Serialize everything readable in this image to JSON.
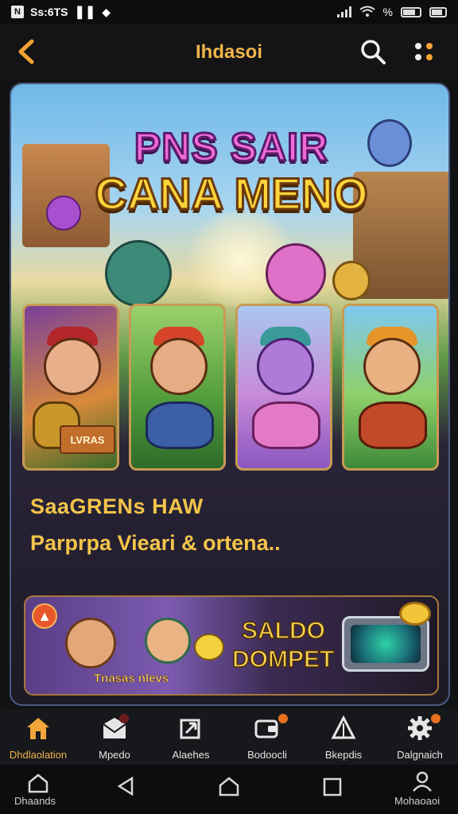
{
  "status_bar": {
    "time_text": "Ss:6TS",
    "battery_text": "%",
    "icons": [
      "notification-icon",
      "app-icon",
      "tag-icon",
      "signal-icon",
      "wifi-icon",
      "battery-icon",
      "cast-icon"
    ]
  },
  "header": {
    "title": "Ihdasoi",
    "back_icon": "chevron-left-icon",
    "search_icon": "search-icon",
    "more_icon": "more-dots-icon",
    "accent_color": "#f4a233"
  },
  "hero": {
    "line1": "PNS SAIR",
    "line2": "CANA MENO"
  },
  "game_tiles": [
    {
      "name": "tile-1",
      "tag": "LVRAS"
    },
    {
      "name": "tile-2"
    },
    {
      "name": "tile-3"
    },
    {
      "name": "tile-4"
    }
  ],
  "promo": {
    "title": "SaaGRENs HAW",
    "subtitle": "Parprpa Vieari & ortena.."
  },
  "banner": {
    "caption": "Tnasas nlevs",
    "saldo": "SALDO",
    "dompet": "DOMPET"
  },
  "bottom_nav": [
    {
      "label": "Dhdlaolation",
      "icon": "home-icon",
      "active": true
    },
    {
      "label": "Mpedo",
      "icon": "mail-icon",
      "active": false
    },
    {
      "label": "Alaehes",
      "icon": "upload-icon",
      "active": false
    },
    {
      "label": "Bodoocli",
      "icon": "wallet-icon",
      "active": false
    },
    {
      "label": "Bkepdis",
      "icon": "triangle-icon",
      "active": false
    },
    {
      "label": "Dalgnaich",
      "icon": "gear-icon",
      "active": false
    }
  ],
  "system_nav": {
    "left_label": "Dhaands",
    "right_label": "Mohaoaoi"
  },
  "colors": {
    "accent": "#f2b24a",
    "background": "#111214",
    "badge": "#e8701f"
  }
}
